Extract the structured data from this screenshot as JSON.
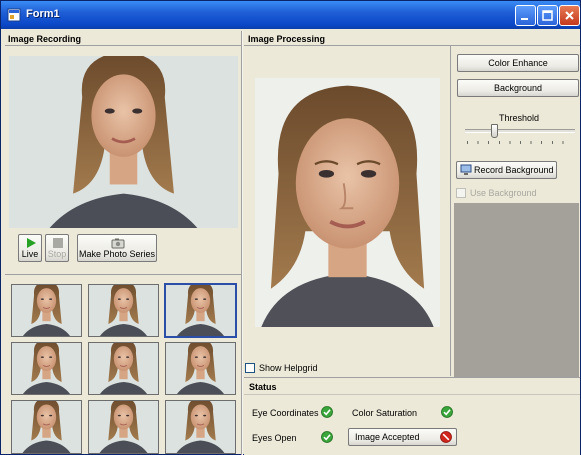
{
  "window": {
    "title": "Form1"
  },
  "recording": {
    "header": "Image Recording",
    "live_label": "Live",
    "stop_label": "Stop",
    "photo_series_label": "Make Photo Series"
  },
  "processing": {
    "header": "Image Processing",
    "show_helpgrid_label": "Show Helpgrid",
    "color_enhance_label": "Color Enhance",
    "background_label": "Background",
    "threshold_label": "Threshold",
    "threshold_level": 0.25,
    "record_background_label": "Record Background",
    "use_background_label": "Use Background"
  },
  "status": {
    "header": "Status",
    "eye_coordinates_label": "Eye Coordinates",
    "color_saturation_label": "Color Saturation",
    "eyes_open_label": "Eyes Open",
    "image_accepted_label": "Image Accepted",
    "ok_color": "#3aa53a",
    "error_color": "#d0261b"
  },
  "icons": {
    "live": "play-icon",
    "stop": "stop-icon",
    "photo_series": "camera-icon",
    "record_background": "monitor-icon",
    "ok": "check-circle-icon",
    "error": "no-entry-icon"
  }
}
